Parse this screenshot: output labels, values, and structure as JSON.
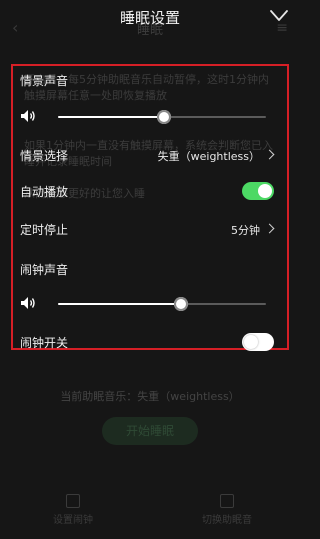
{
  "header": {
    "title": "睡眠设置"
  },
  "background": {
    "title": "睡眠",
    "paragraph_1": "开启后，每5分钟助眠音乐自动暂停，这时1分钟内触摸屏幕任意一处即恢复播放",
    "paragraph_2": "如果1分钟内一直没有触摸屏幕，系统会判断您已入睡并记录睡眠时间",
    "paragraph_3": "从而能够更好的让您入睡",
    "current_music": "当前助眠音乐：失重（weightless）",
    "start_button": "开始睡眠",
    "tabs": [
      "设置闹钟",
      "切换助眠音"
    ]
  },
  "settings": {
    "scene_volume_label": "情景声音",
    "scene_volume_level": 0.51,
    "scene_select_label": "情景选择",
    "scene_select_value": "失重（weightless）",
    "autoplay_label": "自动播放",
    "autoplay_on": true,
    "timer_label": "定时停止",
    "timer_value": "5分钟",
    "alarm_volume_label": "闹钟声音",
    "alarm_volume_level": 0.59,
    "alarm_switch_label": "闹钟开关",
    "alarm_switch_on": false
  },
  "colors": {
    "highlight_border": "#d61f26",
    "toggle_on": "#4cd964",
    "background": "#161616"
  },
  "icons": [
    "chevron-down-icon",
    "speaker-icon",
    "chevron-right-icon",
    "back-arrow-icon",
    "menu-icon"
  ]
}
